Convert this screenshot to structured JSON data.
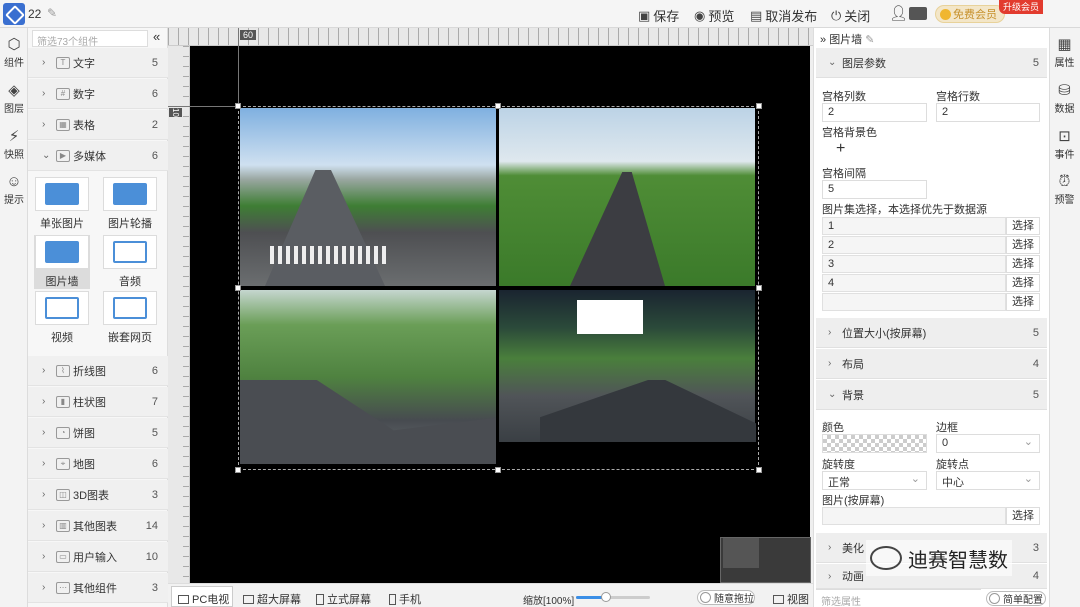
{
  "topbar": {
    "project_name": "22",
    "save": "保存",
    "preview": "预览",
    "unpublish": "取消发布",
    "close": "关闭",
    "member": "免费会员",
    "upgrade": "升级会员"
  },
  "left_strip": [
    {
      "label": "组件",
      "icon": "cube-icon"
    },
    {
      "label": "图层",
      "icon": "layers-icon"
    },
    {
      "label": "快照",
      "icon": "snapshot-icon"
    },
    {
      "label": "提示",
      "icon": "tip-icon"
    }
  ],
  "components": {
    "search_placeholder": "筛选73个组件",
    "categories": [
      {
        "label": "文字",
        "count": "5"
      },
      {
        "label": "数字",
        "count": "6"
      },
      {
        "label": "表格",
        "count": "2"
      },
      {
        "label": "多媒体",
        "count": "6",
        "expanded": true
      },
      {
        "label": "折线图",
        "count": "6"
      },
      {
        "label": "柱状图",
        "count": "7"
      },
      {
        "label": "饼图",
        "count": "5"
      },
      {
        "label": "地图",
        "count": "6"
      },
      {
        "label": "3D图表",
        "count": "3"
      },
      {
        "label": "其他图表",
        "count": "14"
      },
      {
        "label": "用户输入",
        "count": "10"
      },
      {
        "label": "其他组件",
        "count": "3"
      }
    ],
    "media_items": [
      "单张图片",
      "图片轮播",
      "图片墙",
      "音频",
      "视频",
      "嵌套网页"
    ]
  },
  "canvas": {
    "ruler_marker": "60",
    "left_ruler_marker": "10"
  },
  "bottombar": {
    "tabs": [
      "PC电视",
      "超大屏幕",
      "立式屏幕",
      "手机"
    ],
    "zoom_label": "缩放[100%]",
    "zoom_percent": 100,
    "drag_label": "随意拖拉",
    "view_label": "视图"
  },
  "properties": {
    "title": "图片墙",
    "sections": {
      "layer_params": {
        "label": "图层参数",
        "count": "5"
      },
      "position": {
        "label": "位置大小(按屏幕)",
        "count": "5"
      },
      "layout": {
        "label": "布局",
        "count": "4"
      },
      "background": {
        "label": "背景",
        "count": "5"
      },
      "beautify": {
        "label": "美化",
        "count": "3"
      },
      "animation": {
        "label": "动画",
        "count": "4"
      }
    },
    "grid_cols_label": "宫格列数",
    "grid_cols": "2",
    "grid_rows_label": "宫格行数",
    "grid_rows": "2",
    "grid_bg_label": "宫格背景色",
    "grid_gap_label": "宫格间隔",
    "grid_gap": "5",
    "image_set_label": "图片集选择，本选择优先于数据源",
    "image_set": [
      "1",
      "2",
      "3",
      "4",
      ""
    ],
    "choose": "选择",
    "color_label": "颜色",
    "border_label": "边框",
    "border_value": "0",
    "rotation_label": "旋转度",
    "rotation_value": "正常",
    "pivot_label": "旋转点",
    "pivot_value": "中心",
    "image_label": "图片(按屏幕)",
    "filter_placeholder": "筛选属性",
    "simple_config": "简单配置"
  },
  "right_strip": [
    {
      "label": "属性",
      "icon": "property-icon"
    },
    {
      "label": "数据",
      "icon": "database-icon"
    },
    {
      "label": "事件",
      "icon": "event-icon"
    },
    {
      "label": "预警",
      "icon": "alarm-icon"
    }
  ],
  "watermark": "迪赛智慧数"
}
